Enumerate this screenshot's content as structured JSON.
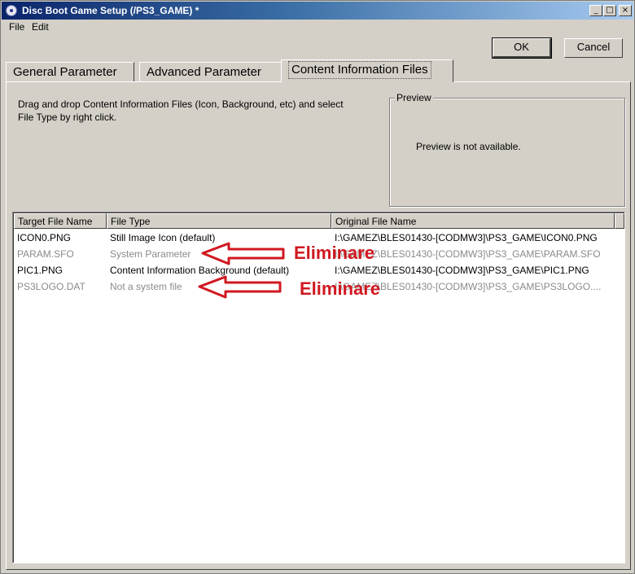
{
  "window": {
    "title": "Disc Boot Game Setup (/PS3_GAME) *",
    "controls": {
      "minimize": "_",
      "maximize": "□",
      "close": "×"
    }
  },
  "menu": {
    "file": "File",
    "edit": "Edit"
  },
  "buttons": {
    "ok": "OK",
    "cancel": "Cancel"
  },
  "tabs": {
    "general": "General Parameter",
    "advanced": "Advanced Parameter",
    "content": "Content Information Files",
    "selected": "content"
  },
  "instructions": "Drag and drop Content Information Files (Icon, Background, etc) and select File Type by right click.",
  "preview": {
    "legend": "Preview",
    "message": "Preview is not available."
  },
  "list": {
    "columns": {
      "target": "Target File Name",
      "type": "File Type",
      "original": "Original File Name"
    },
    "rows": [
      {
        "target": "ICON0.PNG",
        "type": "Still Image Icon (default)",
        "original": "I:\\GAMEZ\\BLES01430-[CODMW3]\\PS3_GAME\\ICON0.PNG",
        "dim": false
      },
      {
        "target": "PARAM.SFO",
        "type": "System Parameter",
        "original": "I:\\GAMEZ\\BLES01430-[CODMW3]\\PS3_GAME\\PARAM.SFO",
        "dim": true
      },
      {
        "target": "PIC1.PNG",
        "type": "Content Information Background (default)",
        "original": "I:\\GAMEZ\\BLES01430-[CODMW3]\\PS3_GAME\\PIC1.PNG",
        "dim": false
      },
      {
        "target": "PS3LOGO.DAT",
        "type": "Not a system file",
        "original": "I:\\GAMEZ\\BLES01430-[CODMW3]\\PS3_GAME\\PS3LOGO....",
        "dim": true
      }
    ]
  },
  "annotations": [
    {
      "label": "Eliminare",
      "color": "#d01820"
    },
    {
      "label": "Eliminare",
      "color": "#d01820"
    }
  ]
}
